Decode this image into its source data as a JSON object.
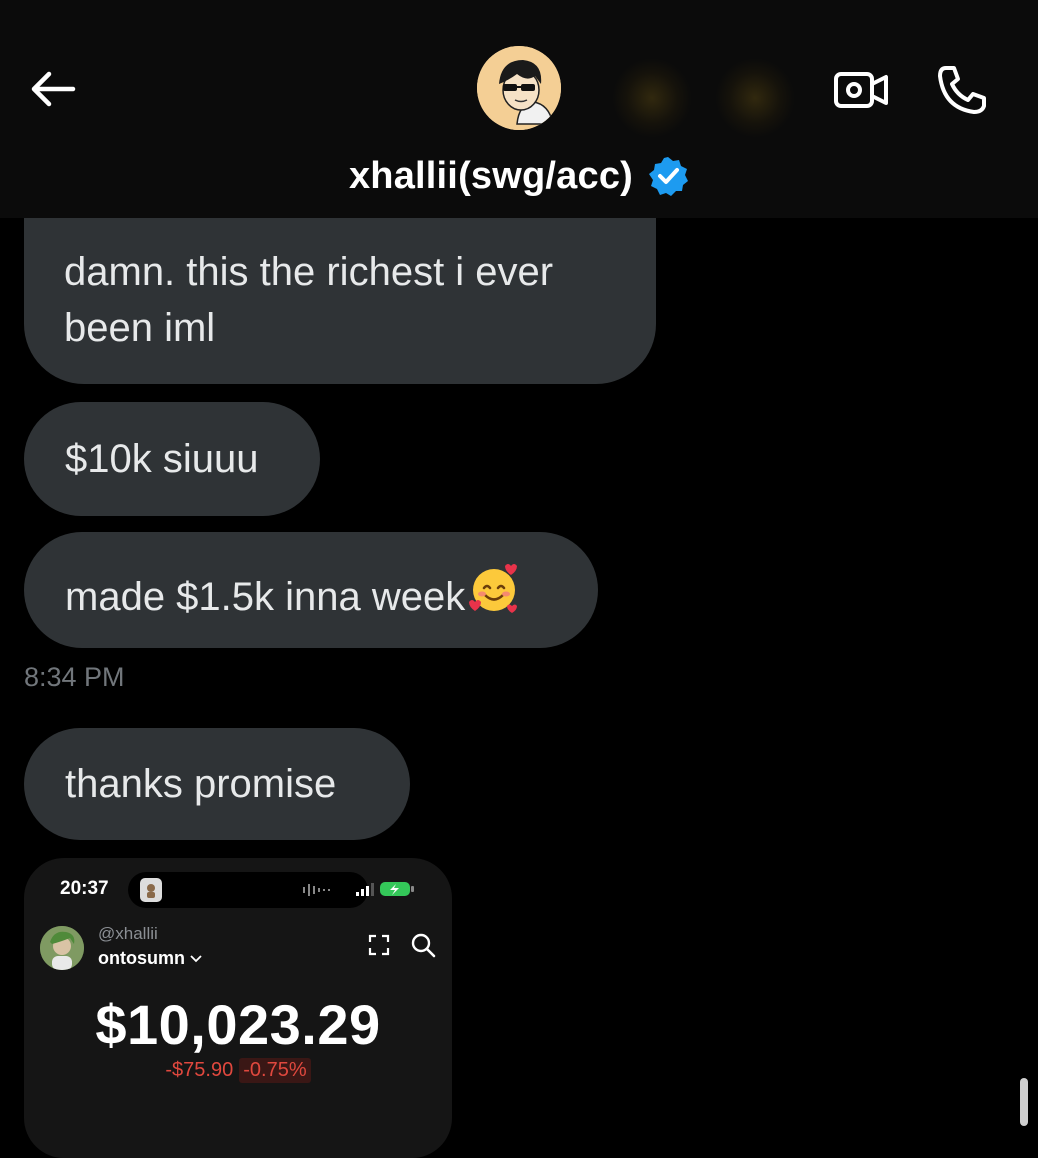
{
  "header": {
    "back_icon": "arrow-left-icon",
    "avatar_icon": "cartoon-sunglasses-avatar",
    "title": "xhallii(swg/acc)",
    "verified_color": "#1d9bf0",
    "video_icon": "video-camera-icon",
    "call_icon": "phone-icon"
  },
  "messages": [
    {
      "text": "damn. this the richest i ever been iml"
    },
    {
      "text": "$10k siuuu"
    },
    {
      "text": "made $1.5k inna week",
      "emoji": "smiling-face-with-hearts"
    },
    {
      "timestamp": "8:34 PM"
    },
    {
      "text": "thanks promise"
    }
  ],
  "attachment": {
    "status_time": "20:37",
    "handle": "@xhallii",
    "account_name": "ontosumn",
    "balance": "$10,023.29",
    "change_amount": "-$75.90",
    "change_percent": "-0.75%",
    "negative_color": "#e0483e"
  }
}
